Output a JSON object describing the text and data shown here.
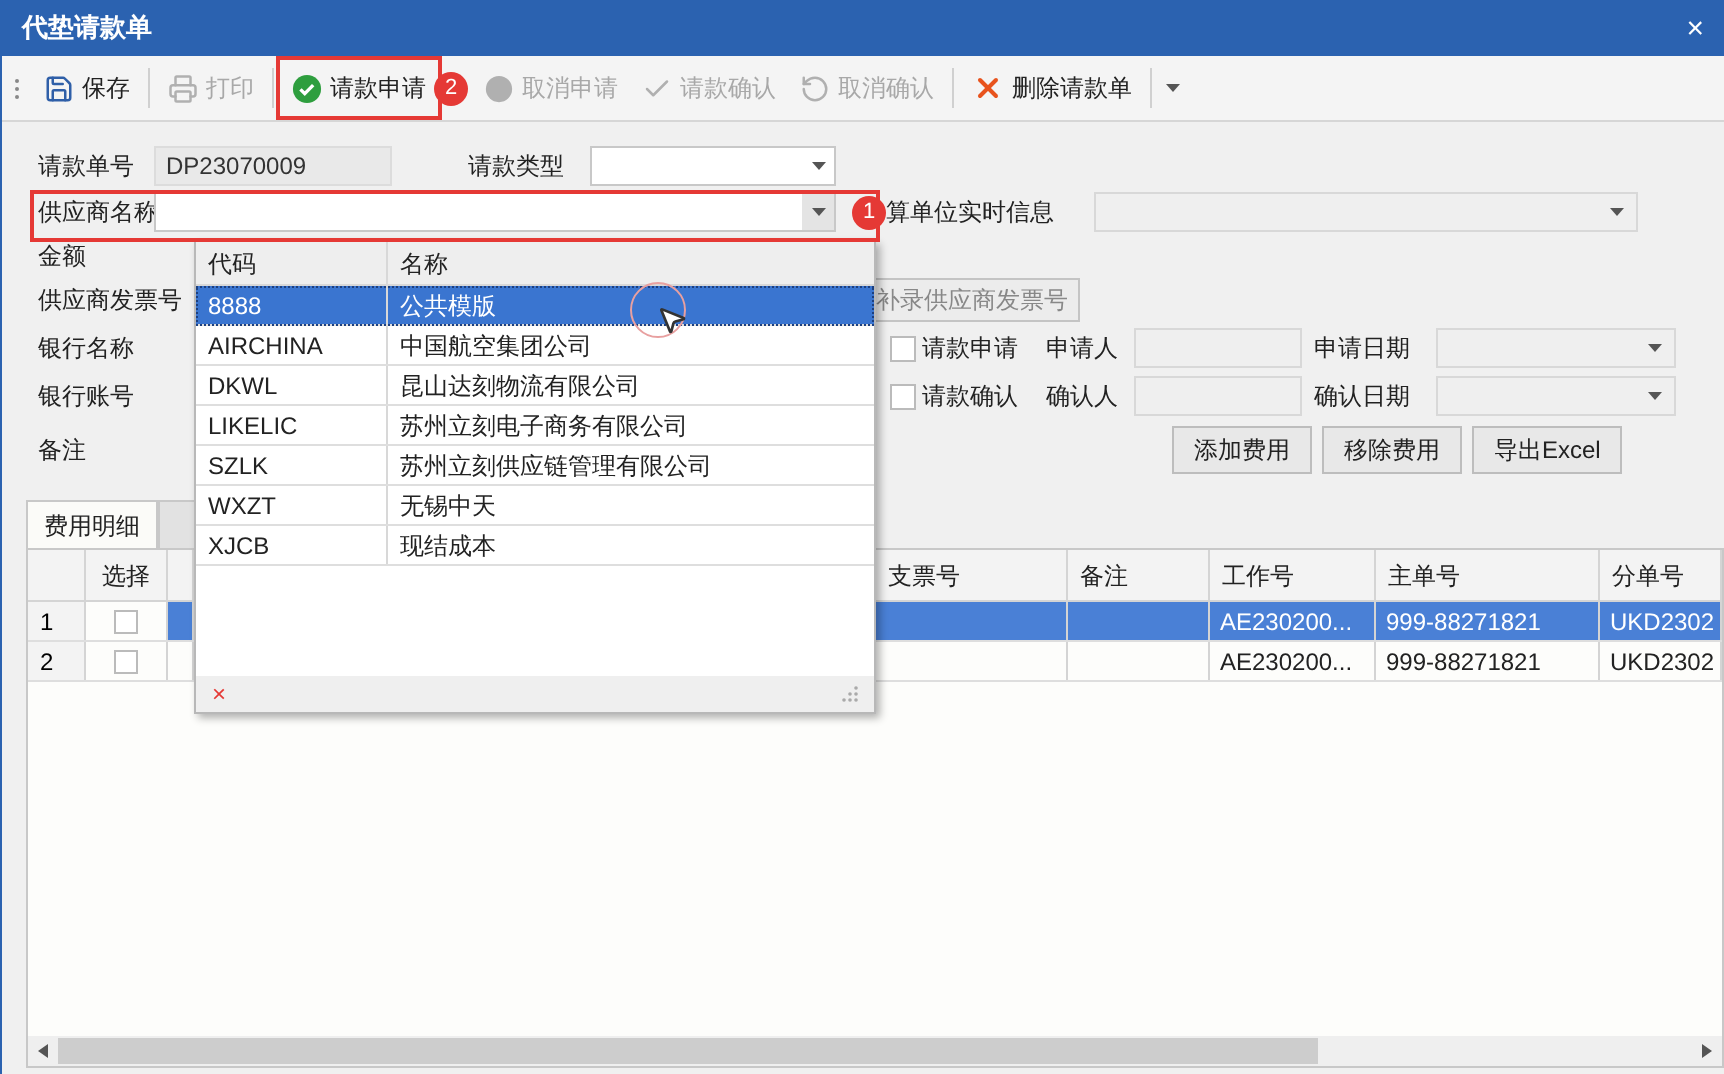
{
  "window": {
    "title": "代垫请款单",
    "close": "×"
  },
  "toolbar": [
    {
      "label": "保存",
      "kind": "save",
      "disabled": false,
      "highlighted": false
    },
    {
      "label": "打印",
      "kind": "print",
      "disabled": true,
      "highlighted": false
    },
    {
      "label": "请款申请",
      "kind": "apply",
      "disabled": false,
      "highlighted": true
    },
    {
      "label": "取消申请",
      "kind": "cancel",
      "disabled": true,
      "highlighted": false
    },
    {
      "label": "请款确认",
      "kind": "confirm",
      "disabled": true,
      "highlighted": false
    },
    {
      "label": "取消确认",
      "kind": "undo",
      "disabled": true,
      "highlighted": false
    },
    {
      "label": "删除请款单",
      "kind": "delete",
      "disabled": false,
      "highlighted": false
    }
  ],
  "annotations": [
    "1",
    "2"
  ],
  "form": {
    "request_no": {
      "label": "请款单号",
      "value": "DP23070009"
    },
    "request_type": {
      "label": "请款类型"
    },
    "supplier": {
      "label": "供应商名称"
    },
    "settlement_info": {
      "label": "算单位实时信息"
    },
    "amount": {
      "label": "金额"
    },
    "supplier_invoice": {
      "label": "供应商发票号",
      "button": "补录供应商发票号"
    },
    "bank_name": {
      "label": "银行名称"
    },
    "bank_account": {
      "label": "银行账号"
    },
    "remark": {
      "label": "备注"
    },
    "apply": {
      "checkbox": "请款申请",
      "checked": false,
      "person_label": "申请人",
      "date_label": "申请日期"
    },
    "confirm": {
      "checkbox": "请款确认",
      "checked": false,
      "person_label": "确认人",
      "date_label": "确认日期"
    },
    "buttons": [
      "添加费用",
      "移除费用",
      "导出Excel"
    ]
  },
  "tabs": [
    {
      "label": "费用明细",
      "selected": true
    },
    {
      "selected": false
    }
  ],
  "table": {
    "columns": [
      "",
      "选择",
      "",
      "支票号",
      "备注",
      "工作号",
      "主单号",
      "分单号"
    ],
    "rows": [
      {
        "index": "1",
        "checked": false,
        "selected": true,
        "cheque": "",
        "remark": "",
        "job": "AE230200...",
        "master": "999-88271821",
        "house": "UKD2302"
      },
      {
        "index": "2",
        "checked": false,
        "selected": false,
        "cheque": "",
        "remark": "",
        "job": "AE230200...",
        "master": "999-88271821",
        "house": "UKD2302"
      }
    ]
  },
  "dropdown": {
    "columns": [
      "代码",
      "名称"
    ],
    "rows": [
      {
        "code": "8888",
        "name": "公共模版",
        "selected": true
      },
      {
        "code": "AIRCHINA",
        "name": "中国航空集团公司",
        "selected": false
      },
      {
        "code": "DKWL",
        "name": "昆山达刻物流有限公司",
        "selected": false
      },
      {
        "code": "LIKELIC",
        "name": "苏州立刻电子商务有限公司",
        "selected": false
      },
      {
        "code": "SZLK",
        "name": "苏州立刻供应链管理有限公司",
        "selected": false
      },
      {
        "code": "WXZT",
        "name": "无锡中天",
        "selected": false
      },
      {
        "code": "XJCB",
        "name": "现结成本",
        "selected": false
      }
    ],
    "clear": "×"
  }
}
